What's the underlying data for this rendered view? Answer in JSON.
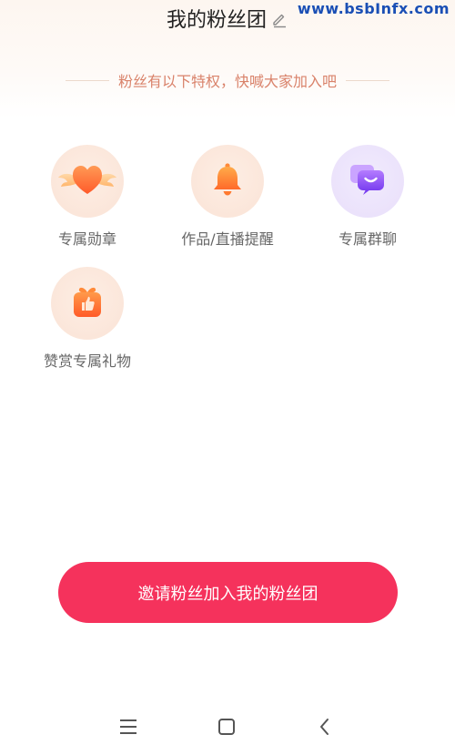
{
  "watermark": "www.bsbInfx.com",
  "header": {
    "title": "我的粉丝团"
  },
  "subtitle": "粉丝有以下特权，快喊大家加入吧",
  "privileges": [
    {
      "label": "专属勋章",
      "icon": "heart-badge-icon"
    },
    {
      "label": "作品/直播提醒",
      "icon": "bell-icon"
    },
    {
      "label": "专属群聊",
      "icon": "chat-bubbles-icon"
    },
    {
      "label": "赞赏专属礼物",
      "icon": "gift-box-icon"
    }
  ],
  "invite_button": {
    "label": "邀请粉丝加入我的粉丝团"
  },
  "nav": {
    "menu": "menu-icon",
    "home": "home-icon",
    "back": "back-icon"
  },
  "colors": {
    "accent": "#f5325c",
    "subtitle": "#d9826a",
    "title": "#222222",
    "label": "#666666",
    "watermark": "#1a4fb5"
  }
}
